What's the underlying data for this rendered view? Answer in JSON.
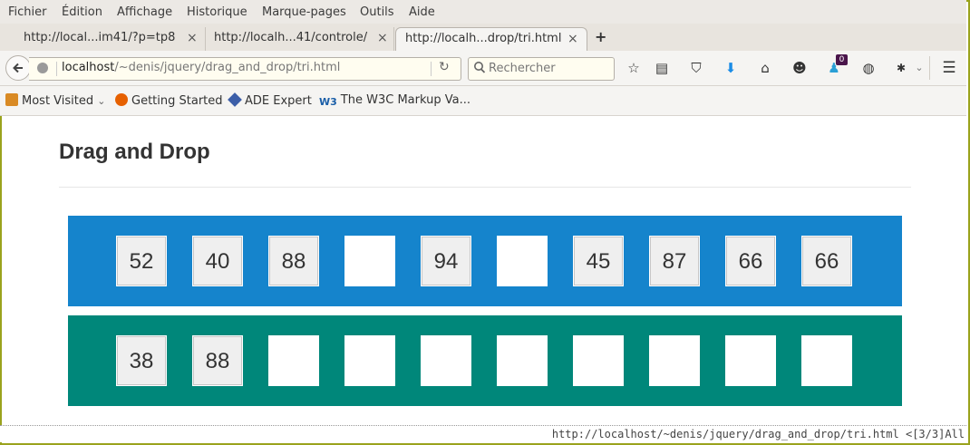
{
  "menu": [
    "Fichier",
    "Édition",
    "Affichage",
    "Historique",
    "Marque-pages",
    "Outils",
    "Aide"
  ],
  "tabs": [
    {
      "label": "http://local...im41/?p=tp8",
      "close": "×"
    },
    {
      "label": "http://localh...41/controle/",
      "close": "×"
    },
    {
      "label": "http://localh...drop/tri.html",
      "close": "×",
      "active": true
    }
  ],
  "new_tab": "+",
  "nav": {
    "url_host": "localhost",
    "url_path": "/~denis/jquery/drag_and_drop/tri.html",
    "search_placeholder": "Rechercher",
    "notification_count": "0"
  },
  "bookmarks": [
    {
      "label": "Most Visited",
      "icon": "folder-icon",
      "chevron": "⌄"
    },
    {
      "label": "Getting Started",
      "icon": "firefox-icon"
    },
    {
      "label": "ADE Expert",
      "icon": "ade-icon"
    },
    {
      "label": "The W3C Markup Va...",
      "icon": "w3c-icon"
    }
  ],
  "page": {
    "title": "Drag and Drop",
    "row1": [
      "52",
      "40",
      "88",
      "",
      "94",
      "",
      "45",
      "87",
      "66",
      "66"
    ],
    "row2": [
      "38",
      "88",
      "",
      "",
      "",
      "",
      "",
      "",
      "",
      ""
    ],
    "colors": {
      "row1": "#1584cc",
      "row2": "#00877a"
    }
  },
  "status": "http://localhost/~denis/jquery/drag_and_drop/tri.html <[3/3]All"
}
